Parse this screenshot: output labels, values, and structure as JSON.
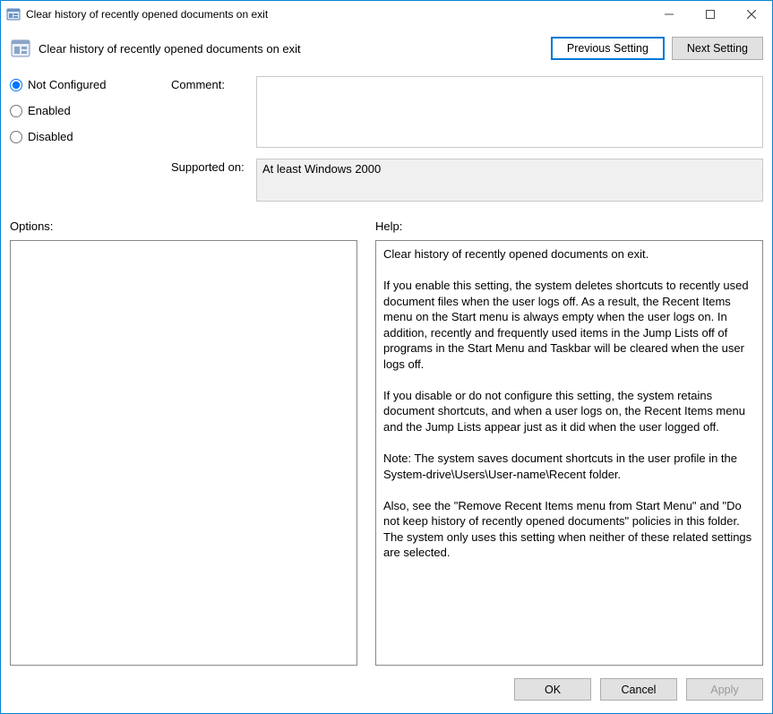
{
  "window": {
    "title": "Clear history of recently opened documents on exit"
  },
  "header": {
    "policy_title": "Clear history of recently opened documents on exit",
    "previous": "Previous Setting",
    "next": "Next Setting"
  },
  "state": {
    "options": {
      "not_configured": "Not Configured",
      "enabled": "Enabled",
      "disabled": "Disabled"
    },
    "selected": "not_configured"
  },
  "fields": {
    "comment_label": "Comment:",
    "comment_value": "",
    "supported_label": "Supported on:",
    "supported_value": "At least Windows 2000"
  },
  "panels": {
    "options_label": "Options:",
    "help_label": "Help:",
    "help_text": "Clear history of recently opened documents on exit.\n\nIf you enable this setting, the system deletes shortcuts to recently used document files when the user logs off. As a result, the Recent Items menu on the Start menu is always empty when the user logs on. In addition, recently and frequently used items in the Jump Lists off of programs in the Start Menu and Taskbar will be cleared when the user logs off.\n\nIf you disable or do not configure this setting, the system retains document shortcuts, and when a user logs on, the Recent Items menu and the Jump Lists appear just as it did when the user logged off.\n\nNote: The system saves document shortcuts in the user profile in the System-drive\\Users\\User-name\\Recent folder.\n\nAlso, see the \"Remove Recent Items menu from Start Menu\" and \"Do not keep history of recently opened documents\" policies in this folder. The system only uses this setting when neither of these related settings are selected."
  },
  "footer": {
    "ok": "OK",
    "cancel": "Cancel",
    "apply": "Apply"
  }
}
